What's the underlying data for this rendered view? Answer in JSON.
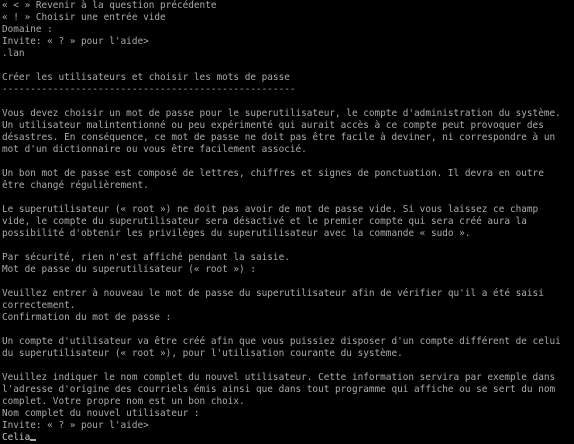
{
  "colors": {
    "background": "#000000",
    "foreground": "#aaaaaa"
  },
  "top_menu": {
    "back_option": "« < » Revenir à la question précédente",
    "empty_option": "« ! » Choisir une entrée vide"
  },
  "domain_prompt": {
    "label": "Domaine :",
    "hint": "Invite: « ? » pour l'aide>",
    "value": ".lan"
  },
  "section": {
    "title": "Créer les utilisateurs et choisir les mots de passe",
    "underline": "----------------------------------------------------"
  },
  "paragraphs": {
    "p1": [
      "Vous devez choisir un mot de passe pour le superutilisateur, le compte d'administration du système.",
      "Un utilisateur malintentionné ou peu expérimenté qui aurait accès à ce compte peut provoquer des",
      "désastres. En conséquence, ce mot de passe ne doit pas être facile à deviner, ni correspondre à un",
      "mot d'un dictionnaire ou vous être facilement associé."
    ],
    "p2": [
      "Un bon mot de passe est composé de lettres, chiffres et signes de ponctuation. Il devra en outre",
      "être changé régulièrement."
    ],
    "p3": [
      "Le superutilisateur (« root ») ne doit pas avoir de mot de passe vide. Si vous laissez ce champ",
      "vide, le compte du superutilisateur sera désactivé et le premier compte qui sera créé aura la",
      "possibilité d'obtenir les privilèges du superutilisateur avec la commande « sudo »."
    ],
    "p4": [
      "Par sécurité, rien n'est affiché pendant la saisie."
    ]
  },
  "root_password_prompt": {
    "label": "Mot de passe du superutilisateur (« root ») :"
  },
  "confirm_paragraph": [
    "Veuillez entrer à nouveau le mot de passe du superutilisateur afin de vérifier qu'il a été saisi",
    "correctement."
  ],
  "confirm_prompt": {
    "label": "Confirmation du mot de passe :"
  },
  "user_paragraph": [
    "Un compte d'utilisateur va être créé afin que vous puissiez disposer d'un compte différent de celui",
    "du superutilisateur (« root »), pour l'utilisation courante du système."
  ],
  "fullname_paragraph": [
    "Veuillez indiquer le nom complet du nouvel utilisateur. Cette information servira par exemple dans",
    "l'adresse d'origine des courriels émis ainsi que dans tout programme qui affiche ou se sert du nom",
    "complet. Votre propre nom est un bon choix."
  ],
  "fullname_prompt": {
    "label": "Nom complet du nouvel utilisateur :",
    "hint": "Invite: « ? » pour l'aide>",
    "value": "Celia"
  }
}
